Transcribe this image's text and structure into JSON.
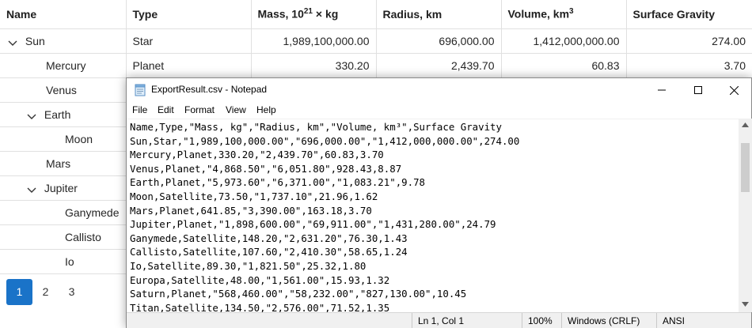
{
  "grid": {
    "columns": [
      {
        "label": "Name"
      },
      {
        "label": "Type"
      },
      {
        "label": "Mass, 10",
        "sup": "21",
        "suffix": " × kg"
      },
      {
        "label": "Radius, km"
      },
      {
        "label": "Volume, km",
        "sup": "3",
        "suffix": ""
      },
      {
        "label": "Surface Gravity"
      }
    ],
    "rows": [
      {
        "name": "Sun",
        "type": "Star",
        "mass": "1,989,100,000.00",
        "radius": "696,000.00",
        "volume": "1,412,000,000.00",
        "gravity": "274.00",
        "level": 0,
        "expanded": true
      },
      {
        "name": "Mercury",
        "type": "Planet",
        "mass": "330.20",
        "radius": "2,439.70",
        "volume": "60.83",
        "gravity": "3.70",
        "level": 1
      },
      {
        "name": "Venus",
        "type": "",
        "mass": "",
        "radius": "",
        "volume": "",
        "gravity": "",
        "level": 1
      },
      {
        "name": "Earth",
        "type": "",
        "mass": "",
        "radius": "",
        "volume": "",
        "gravity": "",
        "level": 1,
        "expanded": true
      },
      {
        "name": "Moon",
        "type": "",
        "mass": "",
        "radius": "",
        "volume": "",
        "gravity": "",
        "level": 2
      },
      {
        "name": "Mars",
        "type": "",
        "mass": "",
        "radius": "",
        "volume": "",
        "gravity": "",
        "level": 1
      },
      {
        "name": "Jupiter",
        "type": "",
        "mass": "",
        "radius": "",
        "volume": "",
        "gravity": "",
        "level": 1,
        "expanded": true
      },
      {
        "name": "Ganymede",
        "type": "",
        "mass": "",
        "radius": "",
        "volume": "",
        "gravity": "",
        "level": 2
      },
      {
        "name": "Callisto",
        "type": "",
        "mass": "",
        "radius": "",
        "volume": "",
        "gravity": "",
        "level": 2
      },
      {
        "name": "Io",
        "type": "",
        "mass": "",
        "radius": "",
        "volume": "",
        "gravity": "",
        "level": 2
      }
    ]
  },
  "pager": {
    "pages": [
      "1",
      "2",
      "3"
    ],
    "active": "1"
  },
  "notepad": {
    "title": "ExportResult.csv - Notepad",
    "menu": [
      "File",
      "Edit",
      "Format",
      "View",
      "Help"
    ],
    "lines": [
      "Name,Type,\"Mass, kg\",\"Radius, km\",\"Volume, km³\",Surface Gravity",
      "Sun,Star,\"1,989,100,000.00\",\"696,000.00\",\"1,412,000,000.00\",274.00",
      "Mercury,Planet,330.20,\"2,439.70\",60.83,3.70",
      "Venus,Planet,\"4,868.50\",\"6,051.80\",928.43,8.87",
      "Earth,Planet,\"5,973.60\",\"6,371.00\",\"1,083.21\",9.78",
      "Moon,Satellite,73.50,\"1,737.10\",21.96,1.62",
      "Mars,Planet,641.85,\"3,390.00\",163.18,3.70",
      "Jupiter,Planet,\"1,898,600.00\",\"69,911.00\",\"1,431,280.00\",24.79",
      "Ganymede,Satellite,148.20,\"2,631.20\",76.30,1.43",
      "Callisto,Satellite,107.60,\"2,410.30\",58.65,1.24",
      "Io,Satellite,89.30,\"1,821.50\",25.32,1.80",
      "Europa,Satellite,48.00,\"1,561.00\",15.93,1.32",
      "Saturn,Planet,\"568,460.00\",\"58,232.00\",\"827,130.00\",10.45",
      "Titan,Satellite,134.50,\"2,576.00\",71.52,1.35"
    ],
    "status": {
      "position": "Ln 1, Col 1",
      "zoom": "100%",
      "line_endings": "Windows (CRLF)",
      "encoding": "ANSI"
    },
    "icons": {
      "app": "notepad-icon",
      "minimize": "minimize-icon",
      "maximize": "maximize-icon",
      "close": "close-icon",
      "expand": "chevron-down-icon"
    }
  },
  "colors": {
    "accent": "#1a73c8",
    "grid_border": "#e0e0e0",
    "statusbar": "#f0f0f0"
  }
}
